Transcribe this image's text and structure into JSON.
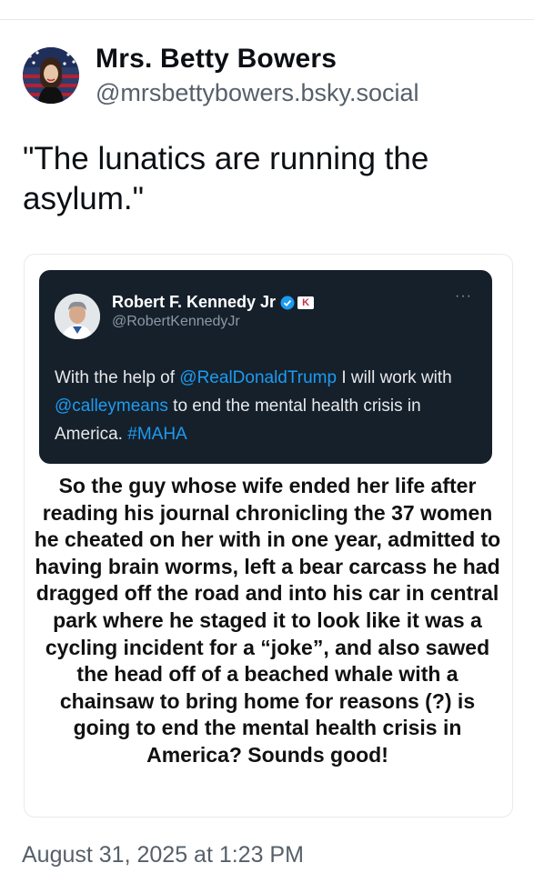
{
  "author": {
    "display_name": "Mrs. Betty Bowers",
    "handle": "@mrsbettybowers.bsky.social",
    "avatar_icon": "profile-photo-woman-flag"
  },
  "post": {
    "text": "\"The lunatics are running the asylum.\"",
    "timestamp": "August 31, 2025 at 1:23 PM"
  },
  "embedded_tweet": {
    "author_name": "Robert F. Kennedy Jr",
    "badge": "K",
    "handle": "@RobertKennedyJr",
    "more": "···",
    "body": {
      "p1": "With the help of ",
      "mention1": "@RealDonaldTrump",
      "p2": " I will work with ",
      "mention2": "@calleymeans",
      "p3": " to end the mental health crisis in America. ",
      "hashtag": "#MAHA"
    },
    "colors": {
      "background": "#15202b",
      "link": "#1d9bf0"
    }
  },
  "caption": "So the guy whose wife ended her life after reading his journal chronicling the 37 women he cheated on her with in one year, admitted to having brain worms, left a bear carcass he had dragged off the road and into his car in central park where he staged it to look like it was a cycling incident for a “joke”, and also sawed the head off of a beached whale with a chainsaw to bring home for reasons (?) is going to end the mental health crisis in America? Sounds good!"
}
